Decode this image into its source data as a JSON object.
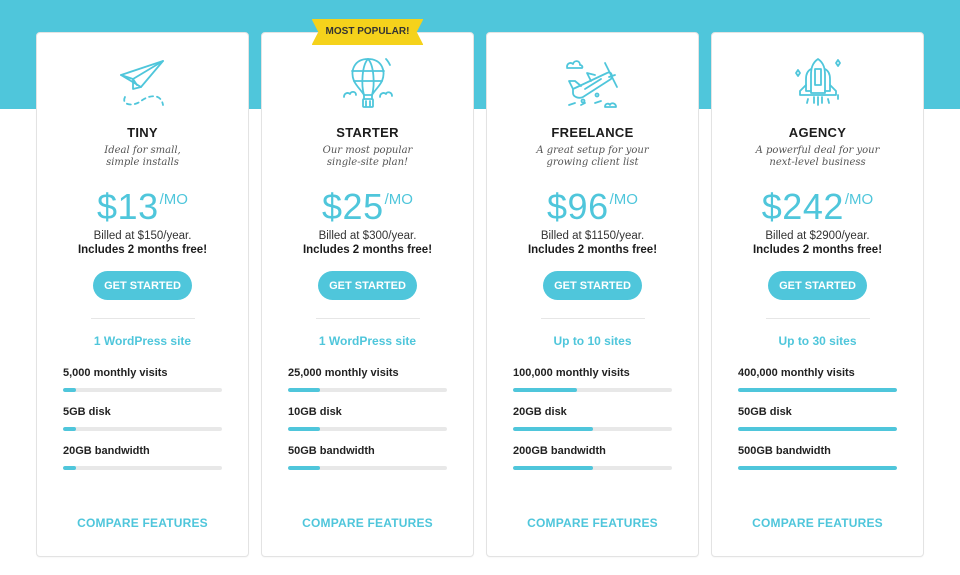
{
  "theme": {
    "accent": "#4fc6db",
    "ribbon": "#f5d21b"
  },
  "plans": [
    {
      "icon": "paper-plane-icon",
      "name": "TINY",
      "description_line1": "Ideal for small,",
      "description_line2": "simple installs",
      "price": "$13",
      "per": "/MO",
      "billed": "Billed at $150/year.",
      "free": "Includes 2 months free!",
      "cta": "GET STARTED",
      "sites": "1 WordPress site",
      "features": [
        {
          "label": "5,000 monthly visits",
          "fill_percent": 8
        },
        {
          "label": "5GB disk",
          "fill_percent": 8
        },
        {
          "label": "20GB bandwidth",
          "fill_percent": 8
        }
      ],
      "compare": "COMPARE FEATURES"
    },
    {
      "icon": "hot-air-balloon-icon",
      "badge": "MOST POPULAR!",
      "name": "STARTER",
      "description_line1": "Our most popular",
      "description_line2": "single-site plan!",
      "price": "$25",
      "per": "/MO",
      "billed": "Billed at $300/year.",
      "free": "Includes 2 months free!",
      "cta": "GET STARTED",
      "sites": "1 WordPress site",
      "features": [
        {
          "label": "25,000 monthly visits",
          "fill_percent": 20
        },
        {
          "label": "10GB disk",
          "fill_percent": 20
        },
        {
          "label": "50GB bandwidth",
          "fill_percent": 20
        }
      ],
      "compare": "COMPARE FEATURES"
    },
    {
      "icon": "propeller-plane-icon",
      "name": "FREELANCE",
      "description_line1": "A great setup for your",
      "description_line2": "growing client list",
      "price": "$96",
      "per": "/MO",
      "billed": "Billed at $1150/year.",
      "free": "Includes 2 months free!",
      "cta": "GET STARTED",
      "sites": "Up to 10 sites",
      "features": [
        {
          "label": "100,000 monthly visits",
          "fill_percent": 40
        },
        {
          "label": "20GB disk",
          "fill_percent": 50
        },
        {
          "label": "200GB bandwidth",
          "fill_percent": 50
        }
      ],
      "compare": "COMPARE FEATURES"
    },
    {
      "icon": "space-shuttle-icon",
      "name": "AGENCY",
      "description_line1": "A powerful deal for your",
      "description_line2": "next-level business",
      "price": "$242",
      "per": "/MO",
      "billed": "Billed at $2900/year.",
      "free": "Includes 2 months free!",
      "cta": "GET STARTED",
      "sites": "Up to 30 sites",
      "features": [
        {
          "label": "400,000 monthly visits",
          "fill_percent": 100
        },
        {
          "label": "50GB disk",
          "fill_percent": 100
        },
        {
          "label": "500GB bandwidth",
          "fill_percent": 100
        }
      ],
      "compare": "COMPARE FEATURES"
    }
  ]
}
